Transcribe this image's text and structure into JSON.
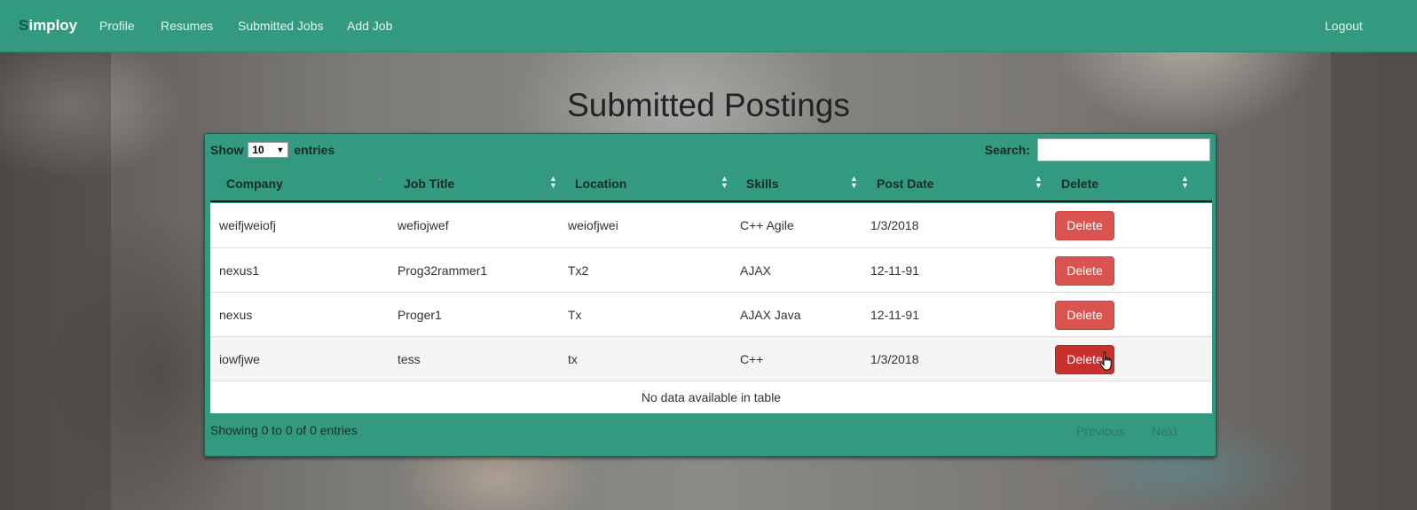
{
  "navbar": {
    "brand_first": "S",
    "brand_rest": "imploy",
    "links": [
      "Profile",
      "Resumes",
      "Submitted Jobs",
      "Add Job"
    ],
    "logout": "Logout"
  },
  "page": {
    "title": "Submitted Postings"
  },
  "table_controls": {
    "show_label": "Show",
    "length_value": "10",
    "entries_label": "entries",
    "search_label": "Search:",
    "search_value": ""
  },
  "table": {
    "columns": [
      "Company",
      "Job Title",
      "Location",
      "Skills",
      "Post Date",
      "Delete"
    ],
    "sorted_column": "Company",
    "sort_direction": "ascending",
    "rows": [
      {
        "company": "weifjweiofj",
        "job_title": "wefiojwef",
        "location": "weiofjwei",
        "skills": "C++ Agile",
        "post_date": "1/3/2018",
        "action": "Delete"
      },
      {
        "company": "nexus1",
        "job_title": "Prog32rammer1",
        "location": "Tx2",
        "skills": "AJAX",
        "post_date": "12-11-91",
        "action": "Delete"
      },
      {
        "company": "nexus",
        "job_title": "Proger1",
        "location": "Tx",
        "skills": "AJAX Java",
        "post_date": "12-11-91",
        "action": "Delete"
      },
      {
        "company": "iowfjwe",
        "job_title": "tess",
        "location": "tx",
        "skills": "C++",
        "post_date": "1/3/2018",
        "action": "Delete"
      }
    ],
    "empty_message": "No data available in table",
    "info": "Showing 0 to 0 of 0 entries",
    "pager": {
      "previous": "Previous",
      "next": "Next"
    }
  },
  "colors": {
    "accent": "#339a80",
    "danger": "#d9534f",
    "danger_hover": "#c9302c"
  },
  "icons": {
    "cursor": "hand-pointer-icon",
    "sort": "sort-arrows-icon"
  }
}
